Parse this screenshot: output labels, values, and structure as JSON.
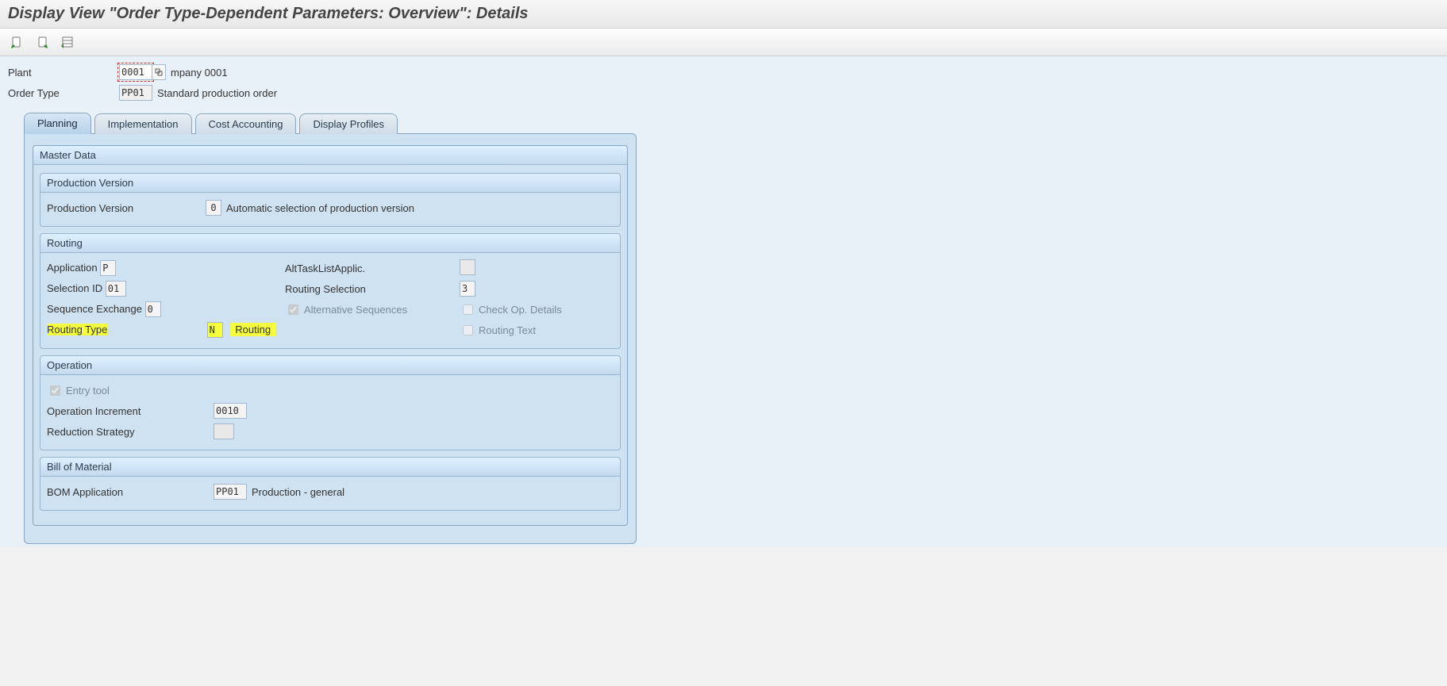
{
  "title": "Display View \"Order Type-Dependent Parameters: Overview\": Details",
  "toolbar_icons": [
    "prev-entry-icon",
    "next-entry-icon",
    "other-entry-icon"
  ],
  "header": {
    "plant_label": "Plant",
    "plant_value": "0001",
    "plant_desc": "mpany 0001",
    "ordertype_label": "Order Type",
    "ordertype_value": "PP01",
    "ordertype_desc": "Standard production order"
  },
  "tabs": {
    "t0": "Planning",
    "t1": "Implementation",
    "t2": "Cost Accounting",
    "t3": "Display Profiles",
    "active": 0
  },
  "master_data": {
    "title": "Master Data",
    "pv_title": "Production Version",
    "pv_label": "Production Version",
    "pv_value": "0",
    "pv_desc": "Automatic selection of production version",
    "routing_title": "Routing",
    "application_label": "Application",
    "application_value": "P",
    "alttl_label": "AltTaskListApplic.",
    "alttl_value": "",
    "selectionid_label": "Selection ID",
    "selectionid_value": "01",
    "routingsel_label": "Routing Selection",
    "routingsel_value": "3",
    "seqexch_label": "Sequence Exchange",
    "seqexch_value": "0",
    "altseq_label": "Alternative Sequences",
    "altseq_checked": true,
    "checkop_label": "Check Op. Details",
    "checkop_checked": false,
    "rt_label": "Routing Type",
    "rt_value": "N",
    "rt_desc": "Routing",
    "rtext_label": "Routing Text",
    "rtext_checked": false,
    "op_title": "Operation",
    "entrytool_label": "Entry tool",
    "entrytool_checked": true,
    "opincr_label": "Operation Increment",
    "opincr_value": "0010",
    "redstrat_label": "Reduction Strategy",
    "redstrat_value": "",
    "bom_title": "Bill of Material",
    "bomapp_label": "BOM Application",
    "bomapp_value": "PP01",
    "bomapp_desc": "Production - general"
  }
}
